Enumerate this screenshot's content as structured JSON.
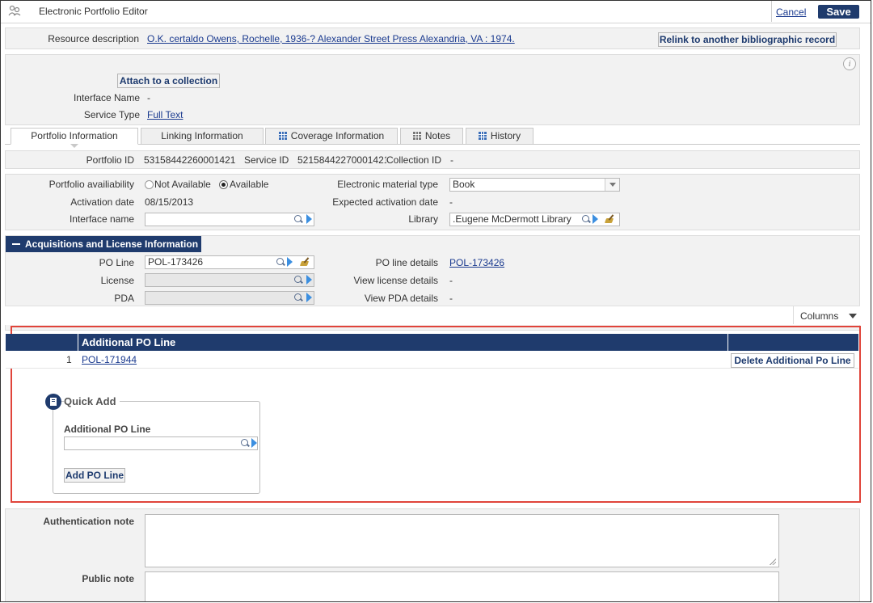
{
  "header": {
    "title": "Electronic Portfolio Editor",
    "cancel_label": "Cancel",
    "save_label": "Save"
  },
  "resource": {
    "label": "Resource description",
    "value": "O.K. certaldo Owens, Rochelle, 1936-? Alexander Street Press Alexandria, VA : 1974.",
    "relink_label": "Relink to another bibliographic record"
  },
  "collection": {
    "attach_label": "Attach to a collection",
    "interface_name_label": "Interface Name",
    "interface_name_value": "-",
    "service_type_label": "Service Type",
    "service_type_value": "Full Text"
  },
  "tabs": [
    {
      "label": "Portfolio Information",
      "active": true,
      "icon": ""
    },
    {
      "label": "Linking Information",
      "active": false,
      "icon": ""
    },
    {
      "label": "Coverage Information",
      "active": false,
      "icon": "grid-icon"
    },
    {
      "label": "Notes",
      "active": false,
      "icon": "grid-icon"
    },
    {
      "label": "History",
      "active": false,
      "icon": "grid-icon"
    }
  ],
  "ids": {
    "portfolio_id_label": "Portfolio ID",
    "portfolio_id_value": "53158442260001421",
    "service_id_label": "Service ID",
    "service_id_value": "52158442270001421",
    "collection_id_label": "Collection ID",
    "collection_id_value": "-"
  },
  "portfolio": {
    "availability_label": "Portfolio availiability",
    "not_available_label": "Not Available",
    "available_label": "Available",
    "selected": "Available",
    "activation_date_label": "Activation date",
    "activation_date_value": "08/15/2013",
    "interface_name_label": "Interface name",
    "interface_name_value": "",
    "material_type_label": "Electronic material type",
    "material_type_value": "Book",
    "expected_activation_label": "Expected activation date",
    "expected_activation_value": "-",
    "library_label": "Library",
    "library_value": ".Eugene McDermott Library"
  },
  "acquisitions": {
    "section_title": "Acquisitions and License Information",
    "po_line_label": "PO Line",
    "po_line_value": "POL-173426",
    "license_label": "License",
    "license_value": "",
    "pda_label": "PDA",
    "pda_value": "",
    "po_line_details_label": "PO line details",
    "po_line_details_value": "POL-173426",
    "view_license_label": "View license details",
    "view_license_value": "-",
    "view_pda_label": "View PDA details",
    "view_pda_value": "-",
    "columns_label": "Columns"
  },
  "additional_po_table": {
    "header": "Additional PO Line",
    "rows": [
      {
        "index": "1",
        "po_line": "POL-171944",
        "action": "Delete Additional Po Line"
      }
    ]
  },
  "quick_add": {
    "title": "Quick Add",
    "field_label": "Additional PO Line",
    "field_value": "",
    "button_label": "Add PO Line"
  },
  "notes": {
    "authentication_label": "Authentication note",
    "authentication_value": "",
    "public_label": "Public note",
    "public_value": ""
  },
  "colors": {
    "accent_navy": "#1f3b6d",
    "link": "#1a3a8f",
    "highlight_border": "#e0443a",
    "panel_bg": "#f2f2f2"
  }
}
